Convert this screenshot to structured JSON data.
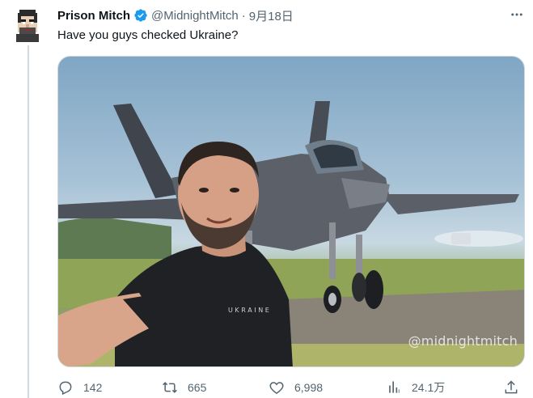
{
  "tweet": {
    "display_name": "Prison Mitch",
    "handle": "@MidnightMitch",
    "separator": "·",
    "date": "9月18日",
    "text": "Have you guys checked Ukraine?",
    "media_watermark": "@midnightmitch",
    "shirt_text": "U K R A I N E"
  },
  "actions": {
    "replies": "142",
    "retweets": "665",
    "likes": "6,998",
    "views": "24.1万"
  },
  "icons": {
    "verified": "verified-badge-icon",
    "more": "more-dots-icon",
    "reply": "reply-icon",
    "retweet": "retweet-icon",
    "like": "heart-icon",
    "views": "views-chart-icon",
    "share": "share-icon"
  },
  "colors": {
    "verified_blue": "#1d9bf0",
    "secondary_text": "#536471",
    "primary_text": "#0f1419"
  }
}
